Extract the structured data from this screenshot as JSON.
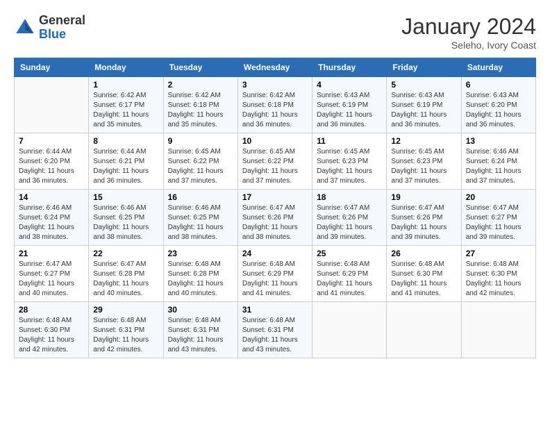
{
  "header": {
    "logo": {
      "text_general": "General",
      "text_blue": "Blue"
    },
    "title": "January 2024",
    "location": "Seleho, Ivory Coast"
  },
  "weekdays": [
    "Sunday",
    "Monday",
    "Tuesday",
    "Wednesday",
    "Thursday",
    "Friday",
    "Saturday"
  ],
  "weeks": [
    [
      {
        "day": "",
        "sunrise": "",
        "sunset": "",
        "daylight": ""
      },
      {
        "day": "1",
        "sunrise": "Sunrise: 6:42 AM",
        "sunset": "Sunset: 6:17 PM",
        "daylight": "Daylight: 11 hours and 35 minutes."
      },
      {
        "day": "2",
        "sunrise": "Sunrise: 6:42 AM",
        "sunset": "Sunset: 6:18 PM",
        "daylight": "Daylight: 11 hours and 35 minutes."
      },
      {
        "day": "3",
        "sunrise": "Sunrise: 6:42 AM",
        "sunset": "Sunset: 6:18 PM",
        "daylight": "Daylight: 11 hours and 36 minutes."
      },
      {
        "day": "4",
        "sunrise": "Sunrise: 6:43 AM",
        "sunset": "Sunset: 6:19 PM",
        "daylight": "Daylight: 11 hours and 36 minutes."
      },
      {
        "day": "5",
        "sunrise": "Sunrise: 6:43 AM",
        "sunset": "Sunset: 6:19 PM",
        "daylight": "Daylight: 11 hours and 36 minutes."
      },
      {
        "day": "6",
        "sunrise": "Sunrise: 6:43 AM",
        "sunset": "Sunset: 6:20 PM",
        "daylight": "Daylight: 11 hours and 36 minutes."
      }
    ],
    [
      {
        "day": "7",
        "sunrise": "Sunrise: 6:44 AM",
        "sunset": "Sunset: 6:20 PM",
        "daylight": "Daylight: 11 hours and 36 minutes."
      },
      {
        "day": "8",
        "sunrise": "Sunrise: 6:44 AM",
        "sunset": "Sunset: 6:21 PM",
        "daylight": "Daylight: 11 hours and 36 minutes."
      },
      {
        "day": "9",
        "sunrise": "Sunrise: 6:45 AM",
        "sunset": "Sunset: 6:22 PM",
        "daylight": "Daylight: 11 hours and 37 minutes."
      },
      {
        "day": "10",
        "sunrise": "Sunrise: 6:45 AM",
        "sunset": "Sunset: 6:22 PM",
        "daylight": "Daylight: 11 hours and 37 minutes."
      },
      {
        "day": "11",
        "sunrise": "Sunrise: 6:45 AM",
        "sunset": "Sunset: 6:23 PM",
        "daylight": "Daylight: 11 hours and 37 minutes."
      },
      {
        "day": "12",
        "sunrise": "Sunrise: 6:45 AM",
        "sunset": "Sunset: 6:23 PM",
        "daylight": "Daylight: 11 hours and 37 minutes."
      },
      {
        "day": "13",
        "sunrise": "Sunrise: 6:46 AM",
        "sunset": "Sunset: 6:24 PM",
        "daylight": "Daylight: 11 hours and 37 minutes."
      }
    ],
    [
      {
        "day": "14",
        "sunrise": "Sunrise: 6:46 AM",
        "sunset": "Sunset: 6:24 PM",
        "daylight": "Daylight: 11 hours and 38 minutes."
      },
      {
        "day": "15",
        "sunrise": "Sunrise: 6:46 AM",
        "sunset": "Sunset: 6:25 PM",
        "daylight": "Daylight: 11 hours and 38 minutes."
      },
      {
        "day": "16",
        "sunrise": "Sunrise: 6:46 AM",
        "sunset": "Sunset: 6:25 PM",
        "daylight": "Daylight: 11 hours and 38 minutes."
      },
      {
        "day": "17",
        "sunrise": "Sunrise: 6:47 AM",
        "sunset": "Sunset: 6:26 PM",
        "daylight": "Daylight: 11 hours and 38 minutes."
      },
      {
        "day": "18",
        "sunrise": "Sunrise: 6:47 AM",
        "sunset": "Sunset: 6:26 PM",
        "daylight": "Daylight: 11 hours and 39 minutes."
      },
      {
        "day": "19",
        "sunrise": "Sunrise: 6:47 AM",
        "sunset": "Sunset: 6:26 PM",
        "daylight": "Daylight: 11 hours and 39 minutes."
      },
      {
        "day": "20",
        "sunrise": "Sunrise: 6:47 AM",
        "sunset": "Sunset: 6:27 PM",
        "daylight": "Daylight: 11 hours and 39 minutes."
      }
    ],
    [
      {
        "day": "21",
        "sunrise": "Sunrise: 6:47 AM",
        "sunset": "Sunset: 6:27 PM",
        "daylight": "Daylight: 11 hours and 40 minutes."
      },
      {
        "day": "22",
        "sunrise": "Sunrise: 6:47 AM",
        "sunset": "Sunset: 6:28 PM",
        "daylight": "Daylight: 11 hours and 40 minutes."
      },
      {
        "day": "23",
        "sunrise": "Sunrise: 6:48 AM",
        "sunset": "Sunset: 6:28 PM",
        "daylight": "Daylight: 11 hours and 40 minutes."
      },
      {
        "day": "24",
        "sunrise": "Sunrise: 6:48 AM",
        "sunset": "Sunset: 6:29 PM",
        "daylight": "Daylight: 11 hours and 41 minutes."
      },
      {
        "day": "25",
        "sunrise": "Sunrise: 6:48 AM",
        "sunset": "Sunset: 6:29 PM",
        "daylight": "Daylight: 11 hours and 41 minutes."
      },
      {
        "day": "26",
        "sunrise": "Sunrise: 6:48 AM",
        "sunset": "Sunset: 6:30 PM",
        "daylight": "Daylight: 11 hours and 41 minutes."
      },
      {
        "day": "27",
        "sunrise": "Sunrise: 6:48 AM",
        "sunset": "Sunset: 6:30 PM",
        "daylight": "Daylight: 11 hours and 42 minutes."
      }
    ],
    [
      {
        "day": "28",
        "sunrise": "Sunrise: 6:48 AM",
        "sunset": "Sunset: 6:30 PM",
        "daylight": "Daylight: 11 hours and 42 minutes."
      },
      {
        "day": "29",
        "sunrise": "Sunrise: 6:48 AM",
        "sunset": "Sunset: 6:31 PM",
        "daylight": "Daylight: 11 hours and 42 minutes."
      },
      {
        "day": "30",
        "sunrise": "Sunrise: 6:48 AM",
        "sunset": "Sunset: 6:31 PM",
        "daylight": "Daylight: 11 hours and 43 minutes."
      },
      {
        "day": "31",
        "sunrise": "Sunrise: 6:48 AM",
        "sunset": "Sunset: 6:31 PM",
        "daylight": "Daylight: 11 hours and 43 minutes."
      },
      {
        "day": "",
        "sunrise": "",
        "sunset": "",
        "daylight": ""
      },
      {
        "day": "",
        "sunrise": "",
        "sunset": "",
        "daylight": ""
      },
      {
        "day": "",
        "sunrise": "",
        "sunset": "",
        "daylight": ""
      }
    ]
  ]
}
